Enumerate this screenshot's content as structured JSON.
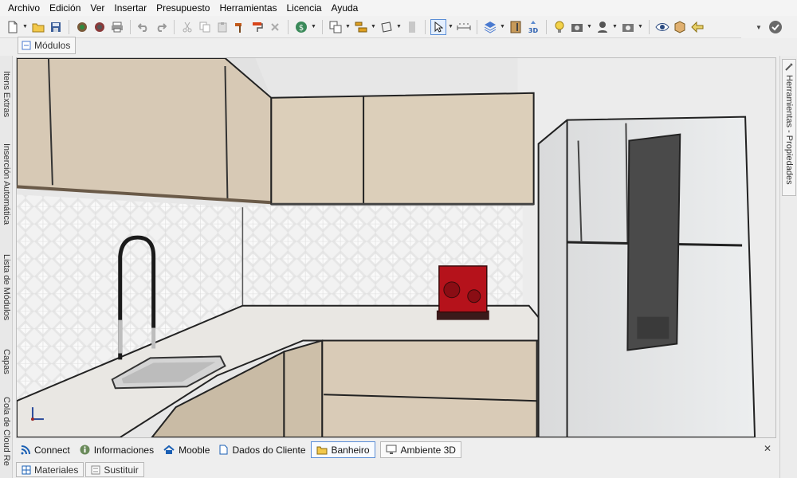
{
  "menu": [
    "Archivo",
    "Edición",
    "Ver",
    "Insertar",
    "Presupuesto",
    "Herramientas",
    "Licencia",
    "Ayuda"
  ],
  "modules_tab": {
    "label": "Módulos"
  },
  "left_tabs": [
    "Itens Extras",
    "Inserción Automática",
    "Lista de Módulos",
    "Capas",
    "Cola de Cloud Re"
  ],
  "right_tab": {
    "label": "Herramientas - Propiedades"
  },
  "toolbar": {
    "badge_3d": "3D"
  },
  "bottom_tabs": [
    {
      "label": "Connect",
      "icon": "rss-icon"
    },
    {
      "label": "Informaciones",
      "icon": "info-icon"
    },
    {
      "label": "Mooble",
      "icon": "home-icon"
    },
    {
      "label": "Dados do Cliente",
      "icon": "document-icon"
    },
    {
      "label": "Banheiro",
      "icon": "folder-icon"
    },
    {
      "label": "Ambiente 3D",
      "icon": "monitor-icon"
    }
  ],
  "footer_tabs": [
    {
      "label": "Materiales"
    },
    {
      "label": "Sustituir"
    }
  ],
  "colors": {
    "cabinet": "#d9cbb7",
    "cabinet_shade": "#c7b8a2",
    "countertop": "#e7e5e1",
    "backsplash": "#f1f1f1",
    "appliance_red": "#b5121b",
    "fridge": "#e6e7e8",
    "fridge_panel": "#4b4b4b"
  }
}
